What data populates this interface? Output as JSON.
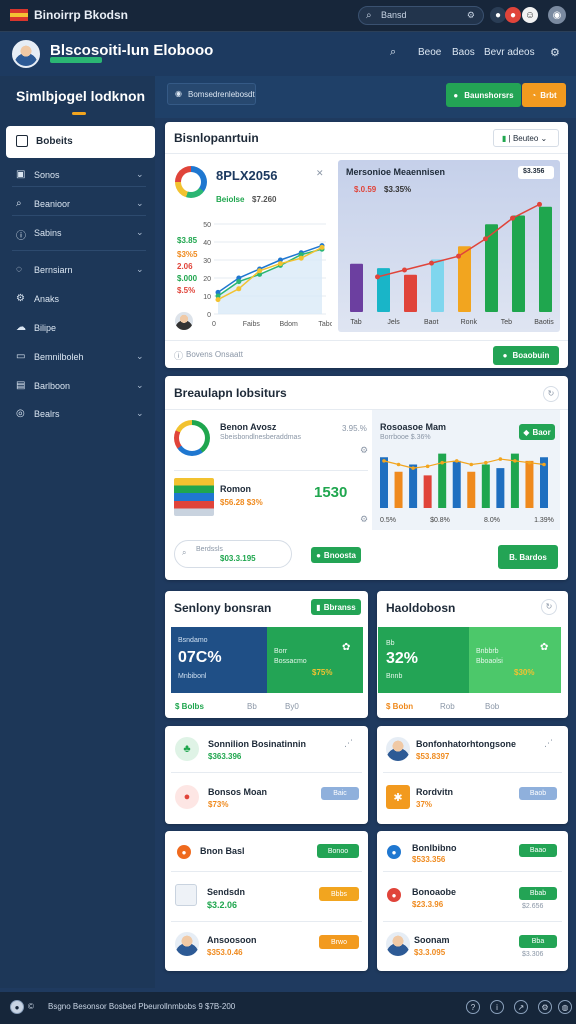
{
  "app": {
    "title": "Binoirrp Bkodsn"
  },
  "topbar": {
    "search": "Bansd",
    "filter_icon": "filter-icon"
  },
  "header": {
    "brand": "Blscosoiti-lun Elobooo",
    "links": [
      "Beoe",
      "Baos",
      "Bevr adeos"
    ]
  },
  "sidebar": {
    "title": "Simlbjogel lodknon",
    "active": "Bobeits",
    "items": [
      {
        "icon": "inbox-icon",
        "label": "Sonos"
      },
      {
        "icon": "search-icon",
        "label": "Beanioor"
      },
      {
        "icon": "info-icon",
        "label": "Sabins"
      },
      {
        "icon": "chat-icon",
        "label": "Bernsiarn"
      },
      {
        "icon": "settings-icon",
        "label": "Anaks"
      },
      {
        "icon": "cloud-icon",
        "label": "Bilipe"
      },
      {
        "icon": "card-icon",
        "label": "Bemnilboleh"
      },
      {
        "icon": "chart-icon",
        "label": "Barlboon"
      },
      {
        "icon": "users-icon",
        "label": "Bealrs"
      }
    ]
  },
  "subbar": {
    "breadcrumb": "Bomsedrenlebosdt",
    "btn_primary": "Baunshorsrs",
    "btn_secondary": "Brbt"
  },
  "overview": {
    "title": "Bisnlopanrtuin",
    "dropdown": "Beuteo",
    "kpi_value": "8PLX2056",
    "kpi_sub_label": "Beiolse",
    "kpi_sub_value": "$7.260",
    "stats": [
      "$3.85",
      "$3%5",
      "2.06",
      "$.000",
      "$.5%"
    ],
    "y_ticks": [
      "50",
      "40",
      "30",
      "20",
      "10",
      "0"
    ],
    "x_ticks": [
      "0",
      "Faibs",
      "Bdom",
      "Tabo"
    ],
    "panel_title": "Mersonioe Meaennisen",
    "panel_badge": "$3.356",
    "panel_value": "$.0.59",
    "panel_value2": "$3.35%",
    "panel_x_ticks": [
      "Tab",
      "Jels",
      "Baot",
      "Ronk",
      "Teb",
      "Baotis"
    ],
    "footer_text": "Bovens Onsaatt",
    "footer_btn": "Boaobuin"
  },
  "breakdown": {
    "title": "Breaulapn Iobsiturs",
    "row1_title": "Benon Avosz",
    "row1_sub": "Sbeisbondlnesberaddmas",
    "row1_pct": "3.95.%",
    "row2_title": "Romon",
    "row2_sub": "$56.28 $3%",
    "row2_value": "1530",
    "panel_title": "Rosoasoe Mam",
    "panel_sub": "Borrbooe $.36%",
    "panel_btn": "Baor",
    "panel_x_ticks": [
      "0.5%",
      "$0.8%",
      "8.0%",
      "1.39%"
    ],
    "input_label": "Berdssls",
    "input_value": "$03.3.195",
    "btn1": "Bnoosta",
    "btn2": "B. Bardos"
  },
  "summary_left": {
    "title": "Senlony bonsran",
    "btn": "Bbranss",
    "tile1_label": "Bsndamo",
    "tile1_value": "07C%",
    "tile1_sub": "Mnbibonl",
    "tile2_label": "Borr",
    "tile2_sub": "Bossacmo",
    "tile2_value": "$75%",
    "footer": [
      "$ Bolbs",
      "Bb",
      "By0"
    ]
  },
  "summary_right": {
    "title": "Haoldobosn",
    "tile1_label": "Bb",
    "tile1_value": "32%",
    "tile1_sub": "Bnnb",
    "tile2_label": "Bnbbrb",
    "tile2_sub": "Bboaolsi",
    "tile2_value": "$30%",
    "footer": [
      "$ Bobn",
      "Rob",
      "Bob"
    ]
  },
  "list_a": [
    {
      "title": "Sonnilion Bosinatinnin",
      "value": "$363.396"
    },
    {
      "title": "Bonsos Moan",
      "value": "$73%",
      "pill": "Baic"
    }
  ],
  "list_b": [
    {
      "title": "Bonfonhatorhtongsone",
      "value": "$53.8397"
    },
    {
      "title": "Rordvitn",
      "value": "37%",
      "pill": "Baob"
    }
  ],
  "list_c": [
    {
      "title": "Bnon Basl",
      "value": "",
      "pill": "Bonoo"
    },
    {
      "title": "Sendsdn",
      "value": "$3.2.06",
      "pill": "Bbbs"
    },
    {
      "title": "Ansoosoon",
      "value": "$353.0.46",
      "pill": "Brwo"
    }
  ],
  "list_d": [
    {
      "title": "Bonlbibno",
      "value": "$533.356",
      "pill": "Baao"
    },
    {
      "title": "Bonoaobe",
      "value": "$23.3.96",
      "pill": "Bbab",
      "note": "$2.656"
    },
    {
      "title": "Soonam",
      "value": "$3.3.095",
      "pill": "Bba",
      "note": "$3.306"
    }
  ],
  "footer": {
    "text": "Bsgno Besonsor Bosbed Pbeurollnmbobs 9 $7B-200"
  },
  "chart_data": [
    {
      "type": "line",
      "x": [
        "0",
        "Faibs",
        "Bdom",
        "Tabo"
      ],
      "y_ticks": [
        "50",
        "40",
        "30",
        "20",
        "10",
        "0"
      ],
      "ylim": [
        0,
        50
      ],
      "series": [
        {
          "color": "#1f77d0",
          "values": [
            12,
            20,
            25,
            30,
            34,
            38
          ]
        },
        {
          "color": "#2bb673",
          "values": [
            10,
            18,
            22,
            27,
            33,
            36
          ]
        },
        {
          "color": "#f2c230",
          "values": [
            8,
            14,
            24,
            28,
            31,
            37
          ]
        }
      ]
    },
    {
      "type": "bar",
      "categories": [
        "Tab",
        "Jels",
        "Baot",
        "Ronk",
        "Teb",
        "Baotis"
      ],
      "values": [
        22,
        20,
        17,
        24,
        30,
        40,
        44,
        48
      ],
      "bar_colors": [
        "#6c3fa0",
        "#19b5c8",
        "#e0443a",
        "#7fd6ee",
        "#f2a51f",
        "#1fa64e",
        "#1fa64e",
        "#1fa64e"
      ],
      "line": [
        18,
        22,
        26,
        30,
        40,
        52,
        60
      ]
    },
    {
      "type": "bar",
      "categories": [
        "0.5%",
        "$0.8%",
        "8.0%",
        "1.39%"
      ],
      "values": [
        28,
        20,
        24,
        18,
        30,
        26,
        20,
        24,
        22,
        30,
        26,
        28
      ],
      "bar_colors": [
        "#1f6fc0",
        "#ef8a1e",
        "#1f6fc0",
        "#e0443a",
        "#1fa64e",
        "#1f6fc0",
        "#ef8a1e",
        "#1fa64e",
        "#1f6fc0",
        "#1fa64e",
        "#ef8a1e",
        "#1f6fc0"
      ],
      "line": [
        26,
        24,
        22,
        23,
        25,
        26,
        24,
        25,
        27,
        26,
        25,
        24
      ]
    }
  ]
}
